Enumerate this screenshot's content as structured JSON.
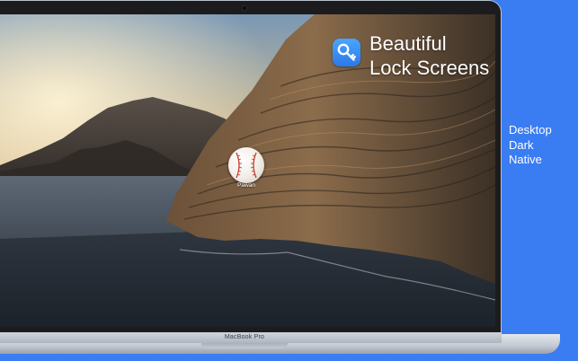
{
  "hero": {
    "line1": "Beautiful",
    "line2": "Lock Screens"
  },
  "app_icon": {
    "name": "key-icon",
    "color": "#2b79e8"
  },
  "lock_screen": {
    "user_name": "Pawan",
    "avatar_icon": "baseball-icon"
  },
  "features": [
    "Desktop",
    "Dark",
    "Native"
  ],
  "device": {
    "model_label": "MacBook Pro"
  },
  "colors": {
    "background": "#3a7cf2",
    "text": "#ffffff"
  }
}
